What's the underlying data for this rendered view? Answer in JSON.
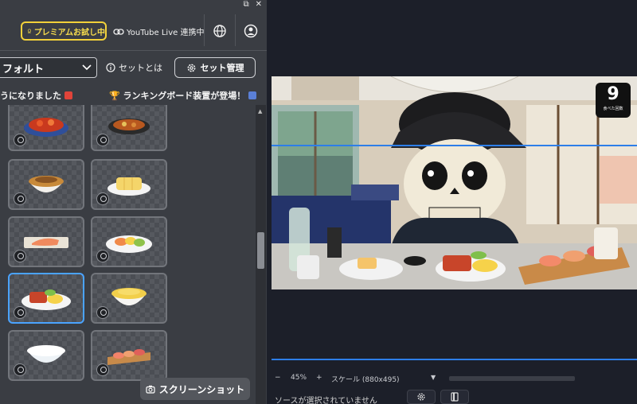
{
  "window_controls": {
    "restore": "⧉",
    "close": "✕"
  },
  "topbar": {
    "premium_label": "プレミアムお試し中",
    "youtube_label": "YouTube Live 連携中"
  },
  "toolbar": {
    "preset_select_value": "フォルト",
    "about_set_label": "セットとは",
    "set_manage_label": "セット管理"
  },
  "ticker": {
    "message1": "うになりました",
    "message2": "ランキングボード装置が登場！"
  },
  "items": [
    {
      "name": "kimchi-jjigae"
    },
    {
      "name": "hot-pot"
    },
    {
      "name": "rice-bowl"
    },
    {
      "name": "tamagoyaki"
    },
    {
      "name": "grilled-salmon"
    },
    {
      "name": "breakfast-plate"
    },
    {
      "name": "french-toast-plate"
    },
    {
      "name": "egg-rice-bowl"
    },
    {
      "name": "white-rice"
    },
    {
      "name": "sushi-plate"
    }
  ],
  "screenshot_button_label": "スクリーンショット",
  "preview": {
    "score_value": "9",
    "score_caption": "食べた回数"
  },
  "zoom": {
    "minus": "−",
    "percent": "45%",
    "plus": "+",
    "scale_label": "スケール (880x495)"
  },
  "status": {
    "no_source_text": "ソースが選択されていません"
  },
  "colors": {
    "premium": "#f2d13a",
    "selection": "#4aa3ff",
    "guide_line": "#2d7ee8"
  }
}
